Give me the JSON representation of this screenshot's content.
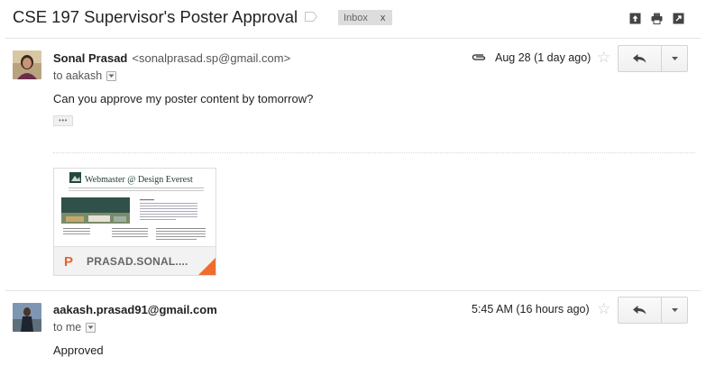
{
  "thread": {
    "subject": "CSE 197 Supervisor's Poster Approval",
    "label": "Inbox",
    "label_remove": "x"
  },
  "messages": [
    {
      "sender_name": "Sonal Prasad",
      "sender_email": "<sonalprasad.sp@gmail.com>",
      "to": "to aakash",
      "date": "Aug 28 (1 day ago)",
      "body": "Can you approve my poster content by tomorrow?",
      "attachment": {
        "filename": "PRASAD.SONAL....",
        "type_icon": "P",
        "preview_title": "Webmaster @ Design Everest"
      }
    },
    {
      "sender_name": "aakash.prasad91@gmail.com",
      "to": "to me",
      "date": "5:45 AM (16 hours ago)",
      "body": "Approved"
    }
  ],
  "icons": {
    "label": "label-icon",
    "archive": "archive-icon",
    "print": "print-icon",
    "new_window": "new-window-icon",
    "attachment": "paperclip-icon",
    "star": "star-icon",
    "reply": "reply-icon",
    "more": "chevron-down-icon"
  },
  "colors": {
    "ppt_orange": "#e8632b",
    "tag_bg": "#dddddd"
  }
}
